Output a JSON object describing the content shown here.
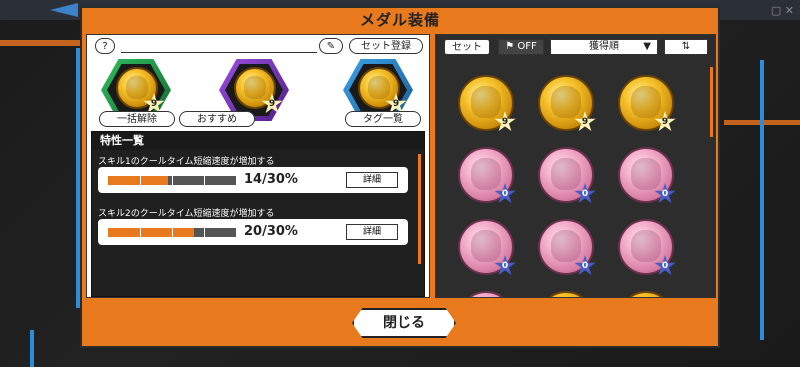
{
  "title": "メダル装備",
  "left": {
    "help_label": "?",
    "set_register_label": "セット登録",
    "slots": [
      {
        "type": "gold",
        "level": "9",
        "frame": "green"
      },
      {
        "type": "gold",
        "level": "9",
        "frame": "purple"
      },
      {
        "type": "gold",
        "level": "9",
        "frame": "blue"
      }
    ],
    "unequip_all_label": "一括解除",
    "recommend_label": "おすすめ",
    "tag_list_label": "タグ一覧",
    "traits_title": "特性一覧",
    "traits": [
      {
        "label": "スキル1のクールタイム短縮速度が増加する",
        "value": "14/30%",
        "progress": 0.47,
        "detail_label": "詳細"
      },
      {
        "label": "スキル2のクールタイム短縮速度が増加する",
        "value": "20/30%",
        "progress": 0.67,
        "detail_label": "詳細"
      }
    ]
  },
  "right": {
    "set_label": "セット",
    "filter_label": "OFF",
    "sort_label": "獲得順",
    "medals": [
      {
        "type": "gold",
        "level": "9"
      },
      {
        "type": "gold",
        "level": "9"
      },
      {
        "type": "gold",
        "level": "9"
      },
      {
        "type": "pink",
        "level": "0"
      },
      {
        "type": "pink",
        "level": "0"
      },
      {
        "type": "pink",
        "level": "0"
      },
      {
        "type": "pink",
        "level": "0"
      },
      {
        "type": "pink",
        "level": "0"
      },
      {
        "type": "pink",
        "level": "0"
      },
      {
        "type": "pink",
        "level": ""
      },
      {
        "type": "gold",
        "level": ""
      },
      {
        "type": "gold",
        "level": ""
      }
    ]
  },
  "close_label": "閉じる",
  "colors": {
    "accent": "#e8791c",
    "blue": "#2a8fd8"
  }
}
